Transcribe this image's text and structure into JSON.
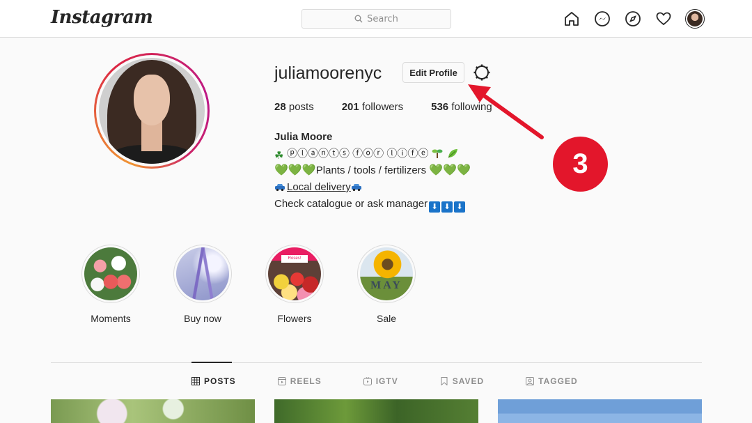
{
  "header": {
    "logo": "Instagram",
    "search_placeholder": "Search",
    "icons": [
      "home-icon",
      "messenger-icon",
      "explore-icon",
      "heart-icon",
      "avatar"
    ]
  },
  "profile": {
    "username": "juliamoorenyc",
    "edit_label": "Edit Profile",
    "posts_count": "28",
    "posts_label": "posts",
    "followers_count": "201",
    "followers_label": "followers",
    "following_count": "536",
    "following_label": "following",
    "name": "Julia Moore",
    "bio_line1": "ⓟⓛⓐⓝⓣⓢ ⓕⓞⓡ ⓛⓘⓕⓔ",
    "bio_line2": "Plants / tools / fertilizers",
    "bio_line3": "Local delivery",
    "bio_line4": "Check catalogue or ask manager"
  },
  "highlights": [
    {
      "label": "Moments"
    },
    {
      "label": "Buy now"
    },
    {
      "label": "Flowers",
      "overlay_text": "Roses!"
    },
    {
      "label": "Sale",
      "overlay_text": "MAY"
    }
  ],
  "tabs": [
    {
      "label": "POSTS",
      "active": true
    },
    {
      "label": "REELS"
    },
    {
      "label": "IGTV"
    },
    {
      "label": "SAVED"
    },
    {
      "label": "TAGGED"
    }
  ],
  "annotation": {
    "number": "3",
    "color": "#e3162b"
  },
  "colors": {
    "accent_heart": "#2ec32e",
    "ring_start": "#f09433",
    "ring_end": "#bc1888"
  }
}
